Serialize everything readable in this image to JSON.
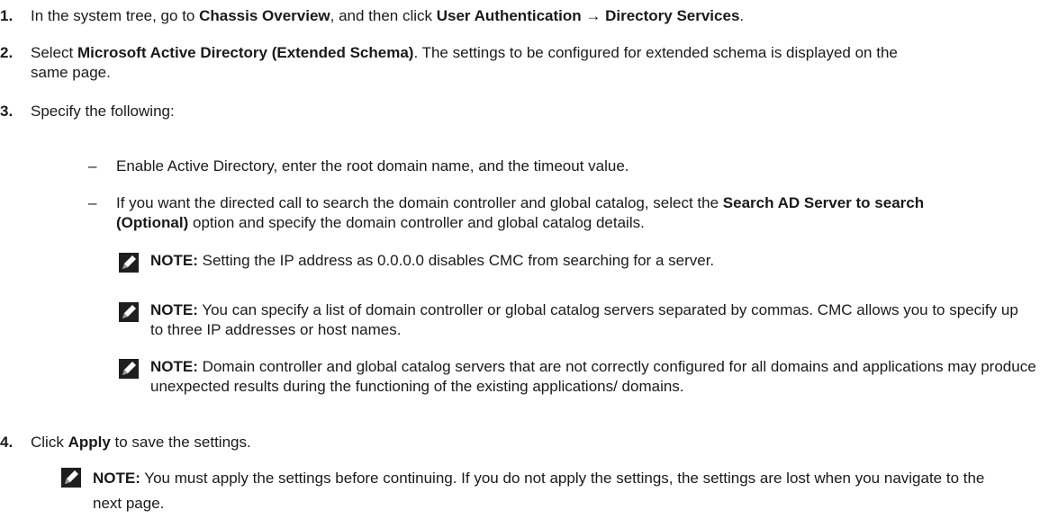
{
  "steps": [
    {
      "num": "1.",
      "parts": [
        {
          "t": "In the system tree, go to "
        },
        {
          "b": "Chassis Overview"
        },
        {
          "t": ", and then click "
        },
        {
          "b": "User Authentication → Directory Services"
        },
        {
          "t": "."
        }
      ]
    },
    {
      "num": "2.",
      "parts": [
        {
          "t": "Select "
        },
        {
          "b": "Microsoft Active Directory (Extended Schema)"
        },
        {
          "t": ". The settings to be configured for extended schema is displayed on the same page."
        }
      ]
    },
    {
      "num": "3.",
      "parts": [
        {
          "t": "Specify the following:"
        }
      ]
    },
    {
      "num": "4.",
      "parts": [
        {
          "t": "Click "
        },
        {
          "b": "Apply"
        },
        {
          "t": " to save the settings."
        }
      ]
    }
  ],
  "sub_items": [
    {
      "dash": "–",
      "parts": [
        {
          "t": "Enable Active Directory, enter the root domain name, and the timeout value."
        }
      ]
    },
    {
      "dash": "–",
      "parts": [
        {
          "t": "If you want the directed call to search the domain controller and global catalog, select the "
        },
        {
          "b": "Search AD Server to search (Optional)"
        },
        {
          "t": " option and specify the domain controller and global catalog details."
        }
      ]
    }
  ],
  "notes": [
    {
      "label": "NOTE:",
      "text": " Setting the IP address as 0.0.0.0 disables CMC from searching for a server."
    },
    {
      "label": "NOTE:",
      "text": " You can specify a list of domain controller or global catalog servers separated by commas. CMC allows you to specify up to three IP addresses or host names."
    },
    {
      "label": "NOTE:",
      "text": " Domain controller and global catalog servers that are not correctly configured for all domains and applications may produce unexpected results during the functioning of the existing applications/ domains."
    },
    {
      "label": "NOTE:",
      "text": " You must apply the settings before continuing. If you do not apply the settings, the settings are lost when you navigate to the next page."
    }
  ],
  "icons": {
    "note": "pencil-note-icon"
  }
}
